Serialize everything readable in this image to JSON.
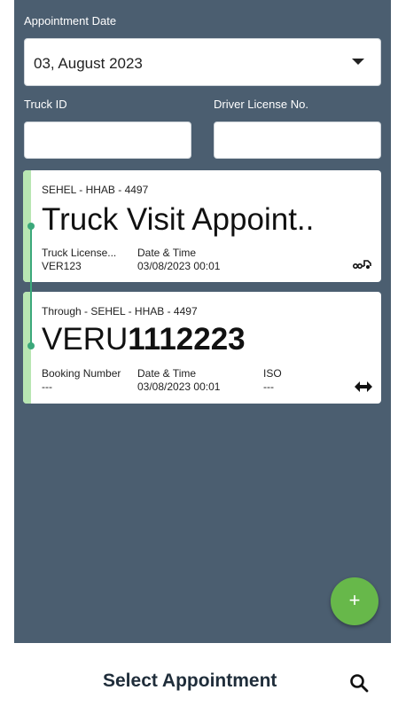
{
  "form": {
    "appointment_date_label": "Appointment Date",
    "appointment_date_value": "03, August 2023",
    "truck_id_label": "Truck ID",
    "truck_id_value": "",
    "driver_license_label": "Driver License No.",
    "driver_license_value": ""
  },
  "appointments": [
    {
      "header": "SEHEL - HHAB - 4497",
      "title": "Truck Visit Appoint..",
      "col1_label": "Truck License...",
      "col1_value": "VER123",
      "col2_label": "Date & Time",
      "col2_value": "03/08/2023 00:01",
      "icon": "truck-trailer-icon"
    },
    {
      "header": "Through - SEHEL - HHAB - 4497",
      "title_prefix": "VERU",
      "title_bold": "1112223",
      "col1_label": "Booking Number",
      "col1_value": "---",
      "col2_label": "Date & Time",
      "col2_value": "03/08/2023 00:01",
      "col3_label": "ISO",
      "col3_value": "---",
      "icon": "two-way-arrow-icon"
    }
  ],
  "fab": {
    "label": "+"
  },
  "bottom_bar": {
    "title": "Select Appointment",
    "icon": "search-icon"
  },
  "colors": {
    "background": "#4b5e70",
    "accent_green": "#67b84a",
    "card_strip": "#b8e6b2",
    "timeline": "#3ba87b"
  }
}
